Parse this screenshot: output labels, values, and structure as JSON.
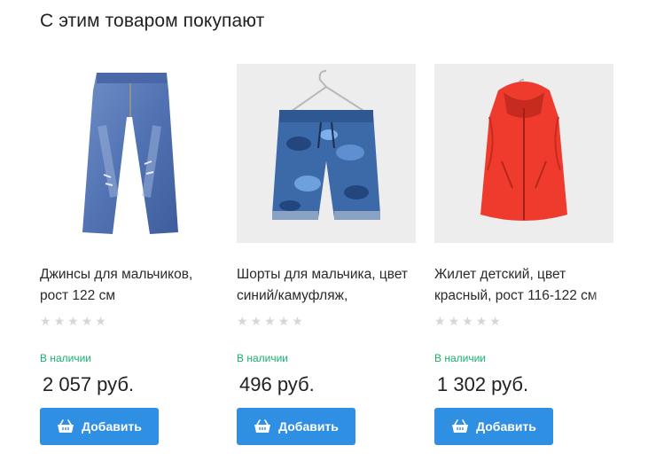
{
  "section": {
    "title": "С этим товаром покупают"
  },
  "products": [
    {
      "name": "Джинсы для мальчиков, рост 122 см",
      "rating": 0,
      "rating_max": 5,
      "stock": "В наличии",
      "price": "2 057 руб.",
      "button": "Добавить",
      "image_icon": "jeans-image"
    },
    {
      "name": "Шорты для мальчика, цвет синий/камуфляж,",
      "rating": 0,
      "rating_max": 5,
      "stock": "В наличии",
      "price": "496 руб.",
      "button": "Добавить",
      "image_icon": "camo-shorts-image"
    },
    {
      "name": "Жилет детский, цвет красный, рост 116-122 см",
      "rating": 0,
      "rating_max": 5,
      "stock": "В наличии",
      "price": "1 302 руб.",
      "button": "Добавить",
      "image_icon": "red-vest-image"
    }
  ],
  "colors": {
    "accent": "#2e8fe3",
    "in_stock": "#1ab26b",
    "star_empty": "#d6d6d6"
  },
  "icons": {
    "button_icon": "basket-icon",
    "star": "star-icon"
  }
}
